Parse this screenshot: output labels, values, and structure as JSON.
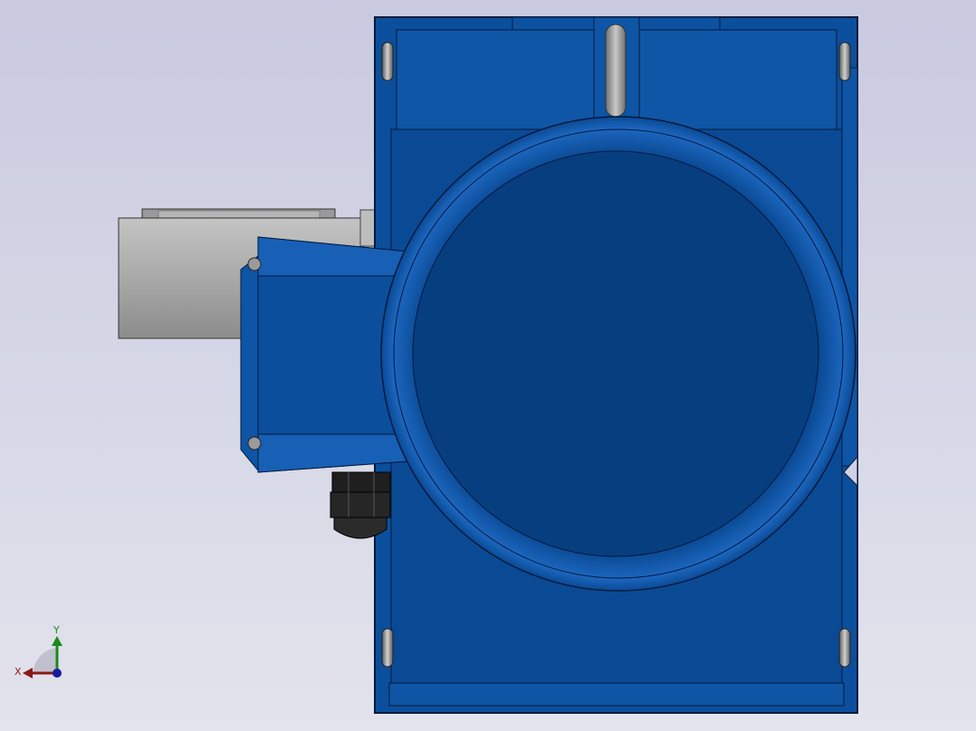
{
  "viewport": {
    "background_top": "#c9cadf",
    "background_bottom": "#e2e3ec"
  },
  "model": {
    "body_color": "#0b4f9c",
    "body_dark": "#063a7a",
    "body_light": "#1d6cc4",
    "edge_color": "#021a3e",
    "gray_part": "#a7a7a7",
    "gray_dark": "#7f7f7f",
    "gland_color": "#1a1a1a"
  },
  "triad": {
    "x_label": "X",
    "y_label": "Y",
    "x_color": "#8b1a1a",
    "y_color": "#1a8a1a",
    "z_color": "#1a1aa0"
  }
}
